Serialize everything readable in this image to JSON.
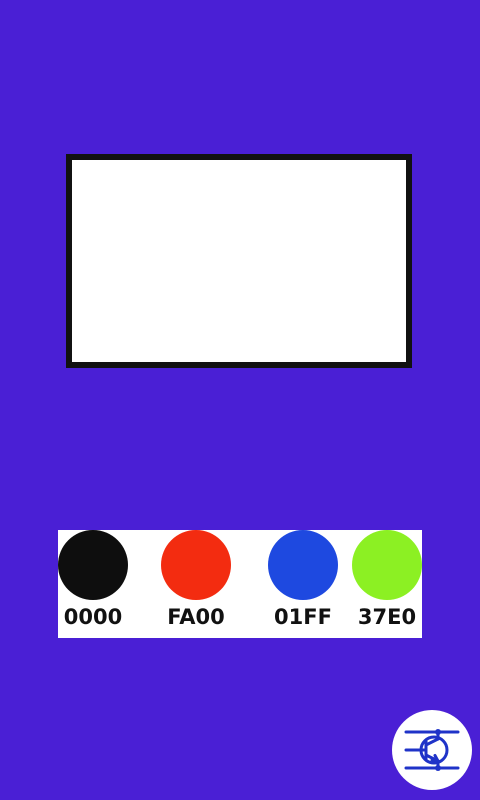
{
  "background_color": "#4a1fd5",
  "display": {
    "fill_color": "#ffffff",
    "border_color": "#111111"
  },
  "palette": {
    "swatches": [
      {
        "label": "0000",
        "color": "#0e0e0e"
      },
      {
        "label": "FA00",
        "color": "#f32c10"
      },
      {
        "label": "01FF",
        "color": "#1e49e0"
      },
      {
        "label": "37E0",
        "color": "#8cf023"
      }
    ]
  },
  "logo": {
    "icon": "transistor-icon",
    "color": "#1f33c8"
  }
}
